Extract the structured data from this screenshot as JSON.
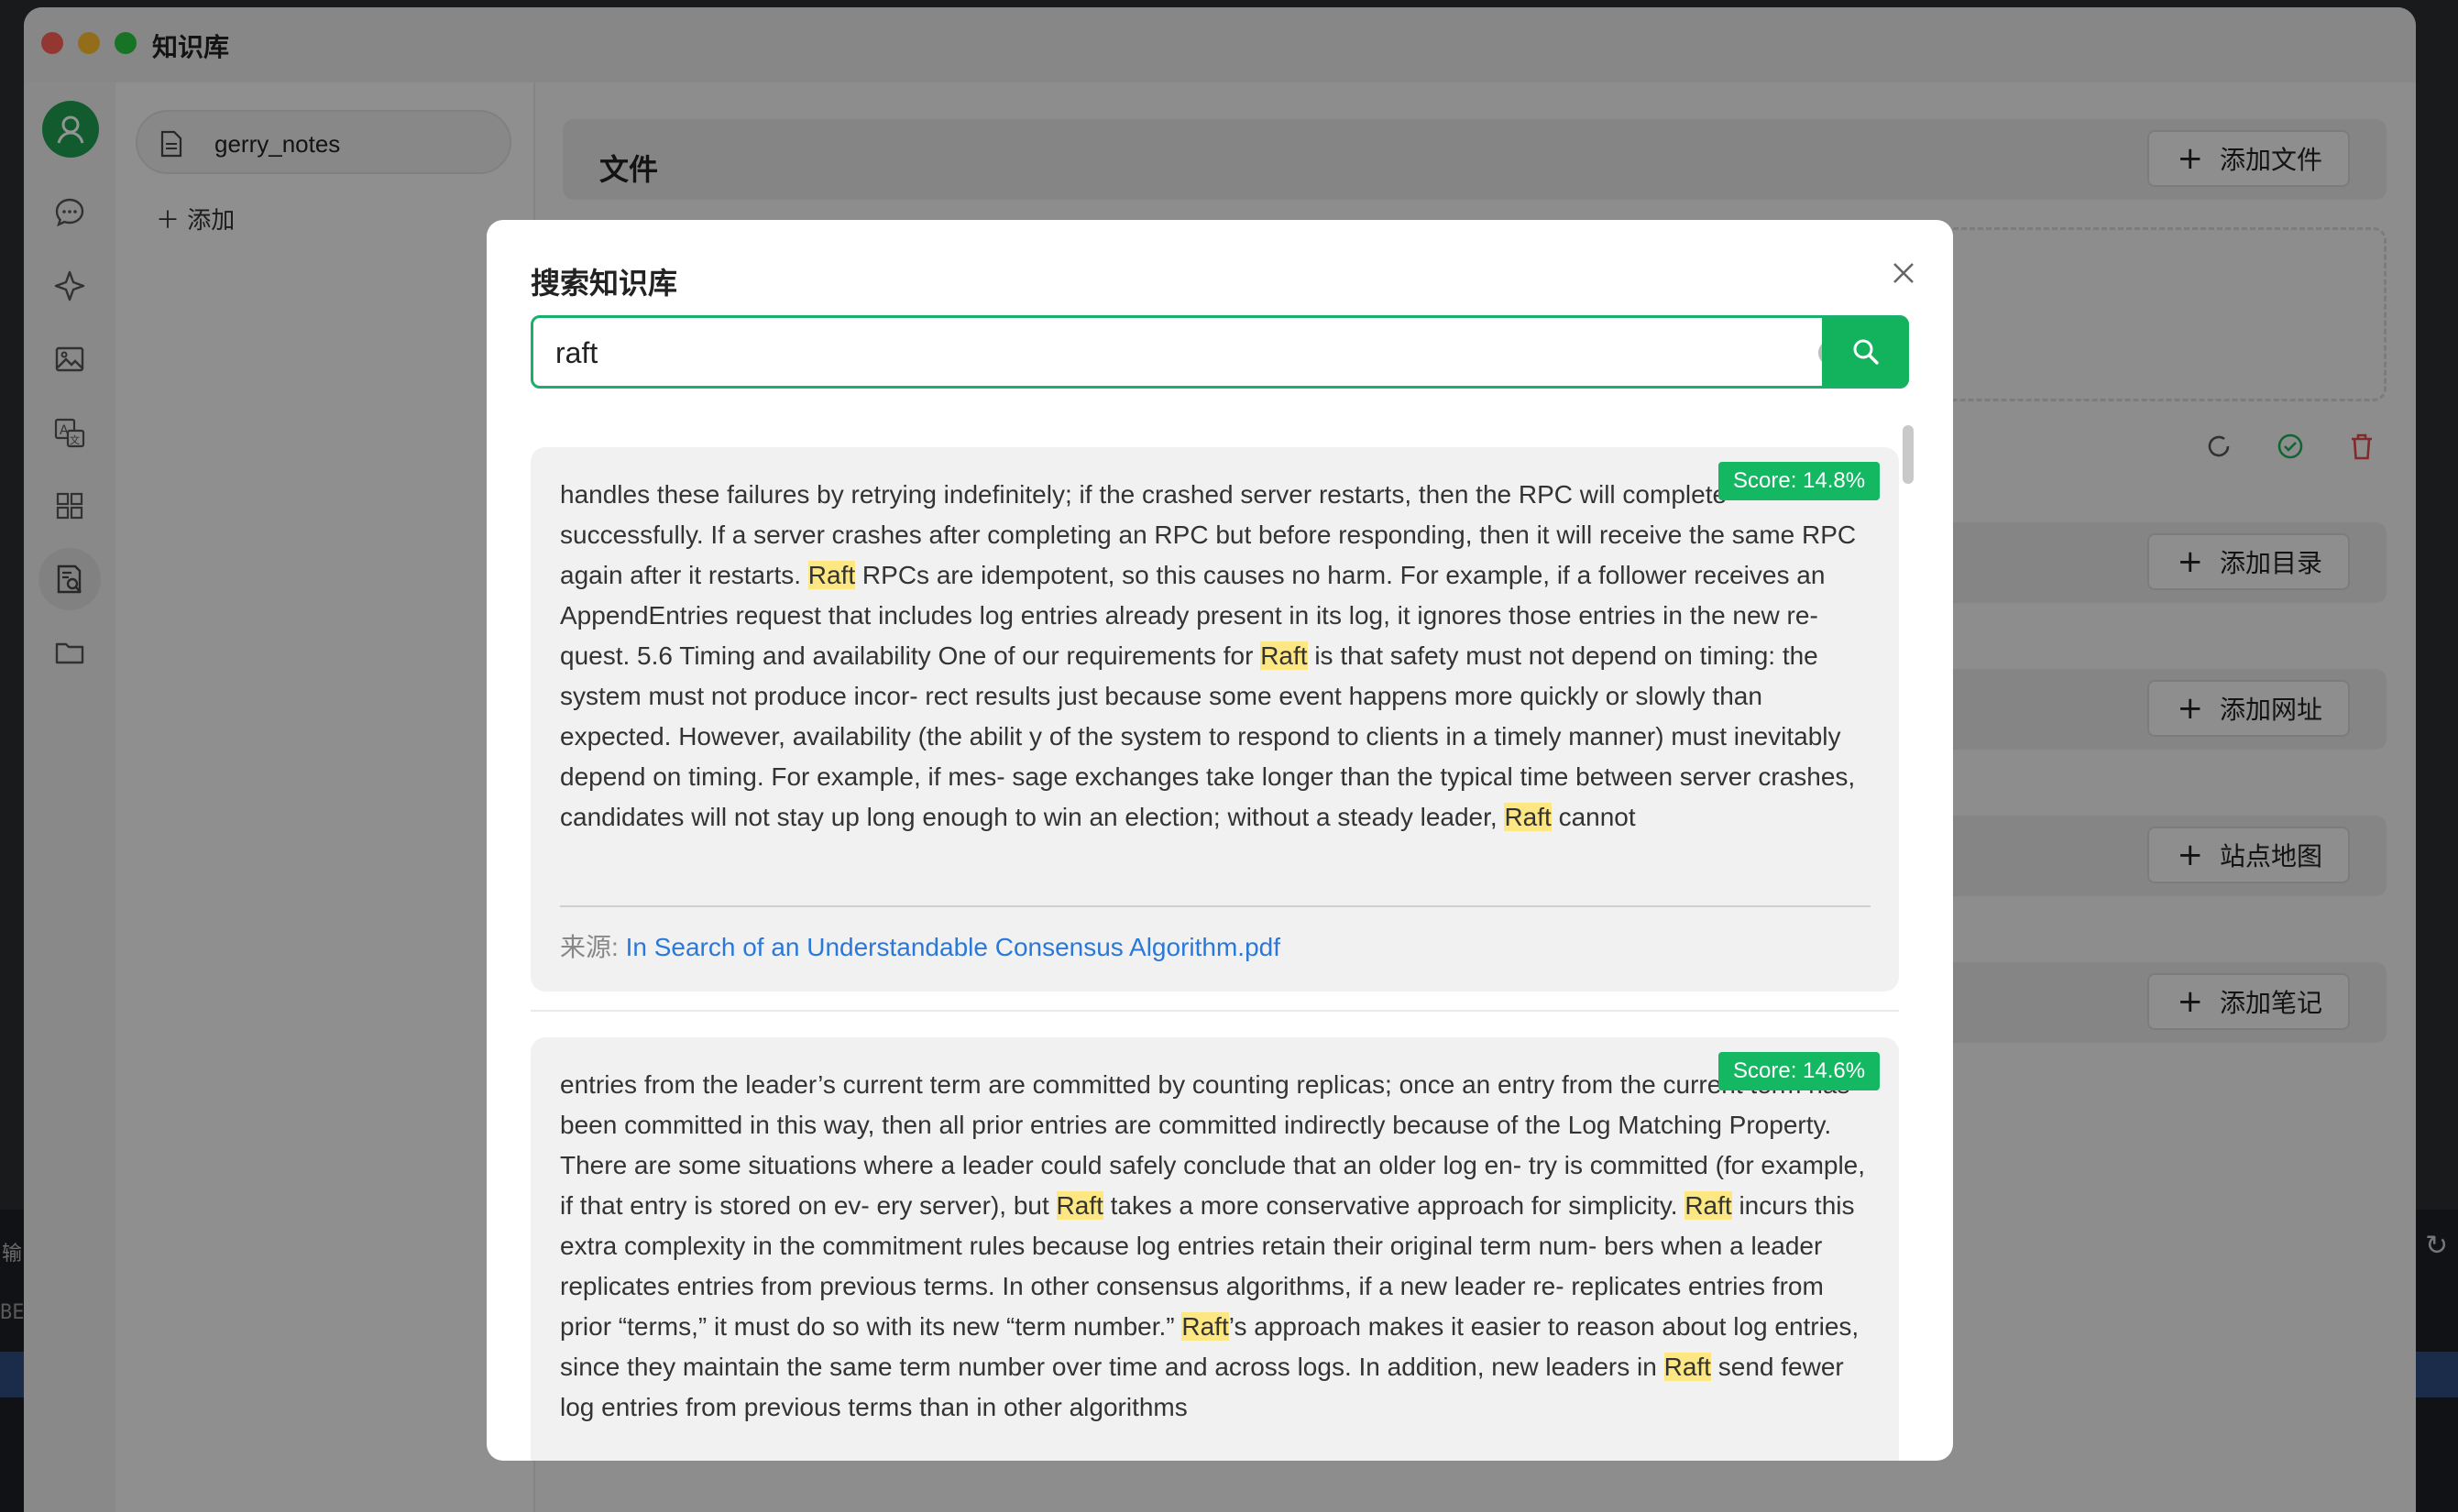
{
  "window": {
    "title": "知识库"
  },
  "desktop": {
    "left_text": "输",
    "left_text2": "BE"
  },
  "rail": {
    "items": [
      "avatar-icon",
      "chat-icon",
      "sparkle-icon",
      "image-icon",
      "translate-icon",
      "apps-icon",
      "knowledge-icon",
      "folder-icon"
    ]
  },
  "kb_list": {
    "items": [
      {
        "label": "gerry_notes"
      }
    ],
    "add_label": "添加"
  },
  "main": {
    "files_title": "文件",
    "buttons": {
      "add_file": "添加文件",
      "add_directory": "添加目录",
      "add_url": "添加网址",
      "sitemap": "站点地图",
      "add_note": "添加笔记"
    }
  },
  "modal": {
    "title": "搜索知识库",
    "search_value": "raft",
    "results": [
      {
        "score": "Score: 14.8%",
        "segments": [
          {
            "t": "handles these failures by retrying indefinitely; if the crashed server restarts, then the RPC will complete successfully. If a server crashes after completing an RPC but before responding, then it will receive the same RPC again after it restarts. "
          },
          {
            "t": "Raft",
            "h": true
          },
          {
            "t": " RPCs are idempotent, so this causes no harm. For example, if a follower receives an AppendEntries request that includes log entries already present in its log, it ignores those entries in the new re- quest. 5.6 Timing and availability One of our requirements for "
          },
          {
            "t": "Raft",
            "h": true
          },
          {
            "t": " is that safety must not depend on timing: the system must not produce incor- rect results just because some event happens more quickly or slowly than expected. However, availability (the abilit y of the system to respond to clients in a timely manner) must inevitably depend on timing. For example, if mes- sage exchanges take longer than the typical time between server crashes, candidates will not stay up long enough to win an election; without a steady leader, "
          },
          {
            "t": "Raft",
            "h": true
          },
          {
            "t": " cannot"
          }
        ],
        "source_label": "来源:",
        "source_file": "In Search of an Understandable Consensus Algorithm.pdf"
      },
      {
        "score": "Score: 14.6%",
        "segments": [
          {
            "t": "entries from the leader’s current term are committed by counting replicas; once an entry from the current term has been committed in this way, then all prior entries are committed indirectly because of the Log Matching Property. There are some situations where a leader could safely conclude that an older log en- try is committed (for example, if that entry is stored on ev- ery server), but "
          },
          {
            "t": "Raft",
            "h": true
          },
          {
            "t": " takes a more conservative approach for simplicity. "
          },
          {
            "t": "Raft",
            "h": true
          },
          {
            "t": " incurs this extra complexity in the commitment rules because log entries retain their original term num- bers when a leader replicates entries from previous terms. In other consensus algorithms, if a new leader re- replicates entries from prior “terms,” it must do so with its new “term number.” "
          },
          {
            "t": "Raft",
            "h": true
          },
          {
            "t": "’s approach makes it easier to reason about log entries, since they maintain the same term number over time and across logs. In addition, new leaders in "
          },
          {
            "t": "Raft",
            "h": true
          },
          {
            "t": " send fewer log entries from previous terms than in other algorithms"
          }
        ]
      }
    ]
  },
  "colors": {
    "accent": "#12b35c",
    "highlight": "#fde782",
    "link": "#2a78d8",
    "delete": "#e04848"
  }
}
